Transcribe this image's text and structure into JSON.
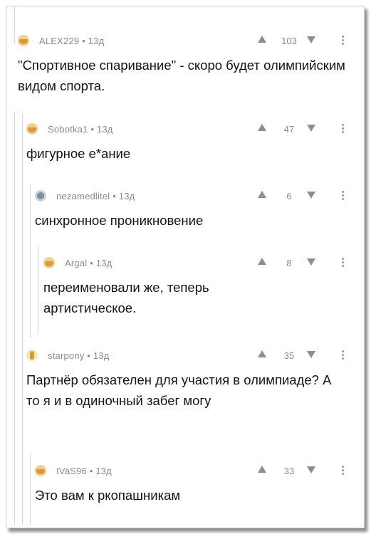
{
  "comments": [
    {
      "username": "ALEX229 • 13д",
      "rating": "103",
      "text": "\"Спортивное спаривание\" - скоро будет олимпийским видом спорта."
    },
    {
      "username": "Sobotka1 • 13д",
      "rating": "47",
      "text": "фигурное е*ание"
    },
    {
      "username": "nezamedlitel • 13д",
      "rating": "6",
      "text": "синхронное проникновение"
    },
    {
      "username": "Argal • 13д",
      "rating": "8",
      "text": "переименовали же, теперь артистическое."
    },
    {
      "username": "starpony • 13д",
      "rating": "35",
      "text": "Партнёр обязателен для участия в олимпиаде? А то я и в одиночный забег могу"
    },
    {
      "username": "IVaS96 • 13д",
      "rating": "33",
      "text": "Это вам к ркопашникам"
    }
  ],
  "colors": {
    "meta": "#8a8a8a",
    "text": "#151515",
    "thread_line": "#d4d4d4"
  }
}
